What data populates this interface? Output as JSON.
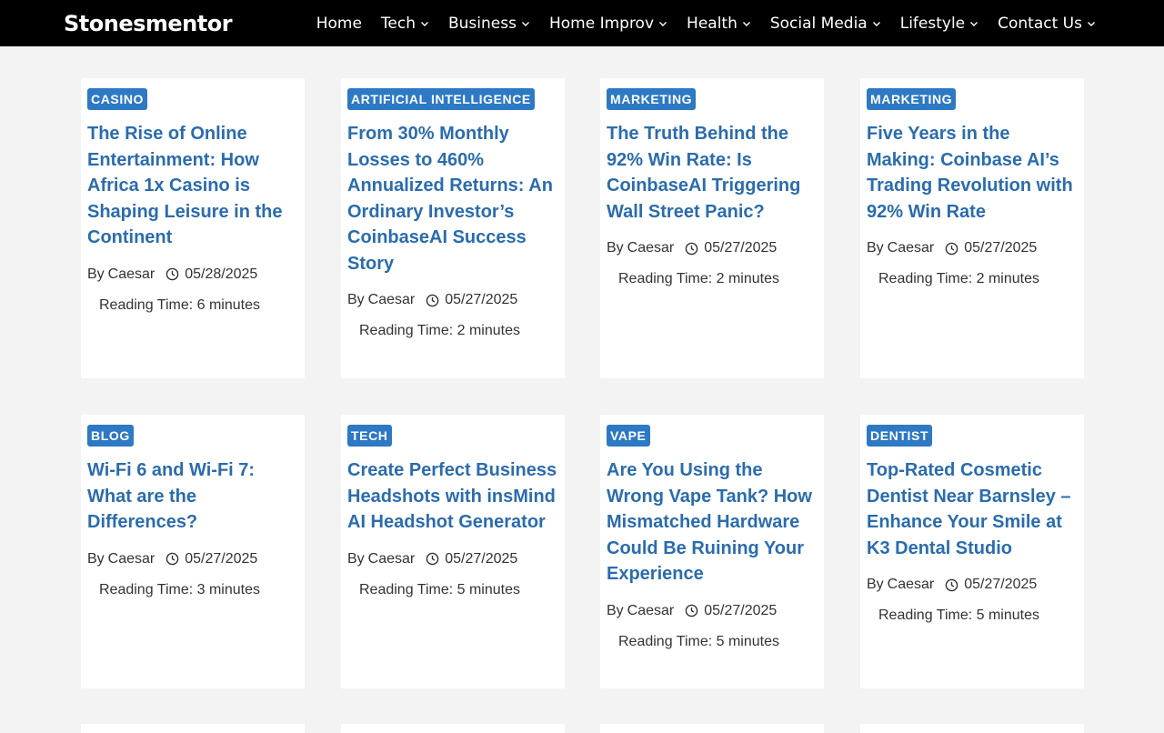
{
  "site": {
    "brand": "Stonesmentor"
  },
  "nav": {
    "items": [
      {
        "label": "Home",
        "has_dropdown": false
      },
      {
        "label": "Tech",
        "has_dropdown": true
      },
      {
        "label": "Business",
        "has_dropdown": true
      },
      {
        "label": "Home Improv",
        "has_dropdown": true
      },
      {
        "label": "Health",
        "has_dropdown": true
      },
      {
        "label": "Social Media",
        "has_dropdown": true
      },
      {
        "label": "Lifestyle",
        "has_dropdown": true
      },
      {
        "label": "Contact Us",
        "has_dropdown": true
      }
    ]
  },
  "meta_labels": {
    "by": "By",
    "reading_prefix": "Reading Time:"
  },
  "posts": [
    {
      "category": "CASINO",
      "title": "The Rise of Online Entertainment: How Africa 1x Casino is Shaping Leisure in the Continent",
      "author": "Caesar",
      "date": "05/28/2025",
      "reading_time": "6 minutes"
    },
    {
      "category": "ARTIFICIAL INTELLIGENCE",
      "title": "From 30% Monthly Losses to 460% Annualized Returns: An Ordinary Investor’s CoinbaseAI Success Story",
      "author": "Caesar",
      "date": "05/27/2025",
      "reading_time": "2 minutes"
    },
    {
      "category": "MARKETING",
      "title": "The Truth Behind the 92% Win Rate: Is CoinbaseAI Triggering Wall Street Panic?",
      "author": "Caesar",
      "date": "05/27/2025",
      "reading_time": "2 minutes"
    },
    {
      "category": "MARKETING",
      "title": "Five Years in the Making: Coinbase AI’s Trading Revolution with 92% Win Rate",
      "author": "Caesar",
      "date": "05/27/2025",
      "reading_time": "2 minutes"
    },
    {
      "category": "BLOG",
      "title": "Wi-Fi 6 and Wi-Fi 7: What are the Differences?",
      "author": "Caesar",
      "date": "05/27/2025",
      "reading_time": "3 minutes"
    },
    {
      "category": "TECH",
      "title": "Create Perfect Business Headshots with insMind AI Headshot Generator",
      "author": "Caesar",
      "date": "05/27/2025",
      "reading_time": "5 minutes"
    },
    {
      "category": "VAPE",
      "title": "Are You Using the Wrong Vape Tank? How Mismatched Hardware Could Be Ruining Your Experience",
      "author": "Caesar",
      "date": "05/27/2025",
      "reading_time": "5 minutes"
    },
    {
      "category": "DENTIST",
      "title": "Top-Rated Cosmetic Dentist Near Barnsley – Enhance Your Smile at K3 Dental Studio",
      "author": "Caesar",
      "date": "05/27/2025",
      "reading_time": "5 minutes"
    }
  ],
  "colors": {
    "header_bg": "#000000",
    "page_bg": "#f3f3f3",
    "badge_bg": "#2d79c4",
    "title_link": "#2b6cad"
  },
  "icons": {
    "date": "clock-icon",
    "dropdown": "chevron-down-icon"
  }
}
